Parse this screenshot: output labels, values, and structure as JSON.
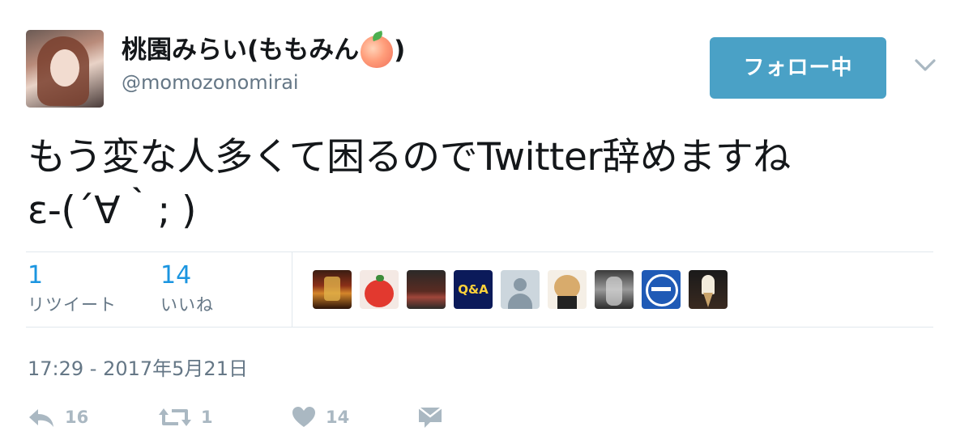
{
  "user": {
    "display_name": "桃園みらい(ももみん",
    "display_name_close": ")",
    "handle": "@momozonomirai",
    "avatar_icon": "profile-photo",
    "emoji_icon": "peach-emoji"
  },
  "follow_button": {
    "label": "フォロー中",
    "color": "#4aa1c6"
  },
  "menu_icon": "chevron-down-icon",
  "tweet": {
    "line1": "もう変な人多くて困るのでTwitter辞めますね",
    "line2": "ε-(´∀｀; )"
  },
  "stats": {
    "retweets": {
      "count": "1",
      "label": "リツイート"
    },
    "likes": {
      "count": "14",
      "label": "いいね"
    }
  },
  "liker_avatars": [
    "liker-avatar-1",
    "liker-avatar-2",
    "liker-avatar-3",
    "liker-avatar-4 (Q&A)",
    "liker-avatar-5 (default)",
    "liker-avatar-6 (teddy bear)",
    "liker-avatar-7",
    "liker-avatar-8 (logo)",
    "liker-avatar-9"
  ],
  "liker_q_and_a": "Q&A",
  "timestamp": "17:29 - 2017年5月21日",
  "actions": {
    "reply": {
      "icon": "reply-icon",
      "count": "16"
    },
    "retweet": {
      "icon": "retweet-icon",
      "count": "1"
    },
    "like": {
      "icon": "heart-icon",
      "count": "14"
    },
    "message": {
      "icon": "envelope-icon"
    }
  },
  "colors": {
    "link_blue": "#1b95e0",
    "muted": "#657786",
    "action_gray": "#aab8c2"
  }
}
